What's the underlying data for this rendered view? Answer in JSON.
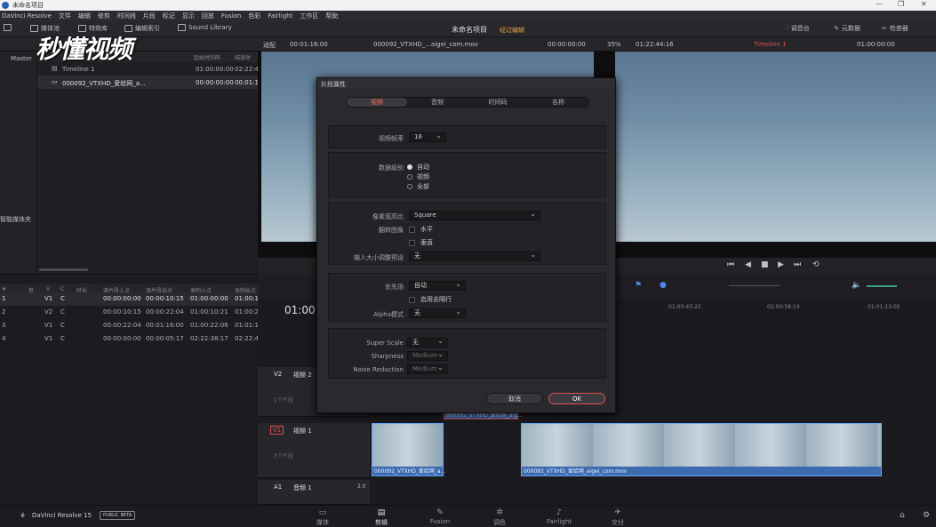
{
  "titlebar": {
    "title": "未命名项目"
  },
  "menubar": {
    "items": [
      "DaVinci Resolve",
      "文件",
      "编辑",
      "修剪",
      "时间线",
      "片段",
      "标记",
      "显示",
      "回放",
      "Fusion",
      "色彩",
      "Fairlight",
      "工作区",
      "帮助"
    ]
  },
  "toolbar": {
    "media_pool": "媒体池",
    "effects": "特效库",
    "edit_index": "编辑索引",
    "sound_library": "Sound Library",
    "project": "未命名项目",
    "edited": "经过编辑",
    "mixer": "调音台",
    "metadata": "元数据",
    "inspector": "检查器"
  },
  "watermark": "秒懂视频",
  "subbar": {
    "fit": "适配",
    "tc_left": "00:01:16:00",
    "clip_name": "000092_VTXHD_...aigei_com.mov",
    "tc_src": "00:00:00:00",
    "zoom": "35%",
    "tc_dur": "01:22:44:16",
    "timeline_name": "Timeline 1",
    "tc_right": "01:00:00:00"
  },
  "left": {
    "master": "Master",
    "smart_bins": "智能媒体夹"
  },
  "bin": {
    "headers": [
      "片段名称",
      "起始时间码",
      "结束时"
    ],
    "rows": [
      {
        "name": "Timeline 1",
        "start": "01:00:00:00",
        "end": "02:22:4"
      },
      {
        "name": "000092_VTXHD_爱给网_a...",
        "start": "00:00:00:00",
        "end": "00:01:1"
      }
    ]
  },
  "edit_index": {
    "headers": [
      "#",
      "卷",
      "V",
      "C",
      "时长",
      "源片段入点",
      "源片段出点",
      "录制入点",
      "录制出点"
    ],
    "rows": [
      [
        "1",
        "",
        "V1",
        "C",
        "",
        "00:00:00:00",
        "00:00:10:15",
        "01:00:00:00",
        "01:00:1"
      ],
      [
        "2",
        "",
        "V2",
        "C",
        "",
        "00:00:10:15",
        "00:00:22:04",
        "01:00:10:21",
        "01:00:2"
      ],
      [
        "3",
        "",
        "V1",
        "C",
        "",
        "00:00:22:04",
        "00:01:16:00",
        "01:00:22:06",
        "01:01:1"
      ],
      [
        "4",
        "",
        "V1",
        "C",
        "",
        "00:00:00:00",
        "00:00:05:17",
        "02:22:38:17",
        "02:22:4"
      ]
    ]
  },
  "timeline": {
    "tc": "01:00:",
    "ruler": [
      "01:00:43:22",
      "01:00:58:14",
      "01:01:13:05"
    ],
    "v2": {
      "id": "V2",
      "name": "视频 2",
      "clips": "1个片段"
    },
    "v1": {
      "id": "V1",
      "name": "视频 1",
      "clips": "3个片段"
    },
    "a1": {
      "id": "A1",
      "name": "音频 1",
      "level": "2.0"
    },
    "clip_a": "000092_VTXHD_爱给网_a...",
    "clip_b": "000092_VTXHD_爱给网_aigei_com.mov",
    "clip_c": "000092_VTXHD_爱给网_aig..."
  },
  "dialog": {
    "title": "片段属性",
    "tabs": [
      "视频",
      "音频",
      "时间码",
      "名称"
    ],
    "fps_label": "视频帧率",
    "fps": "16",
    "data_levels_label": "数据级别",
    "levels": [
      "自动",
      "视频",
      "全部"
    ],
    "par_label": "像素宽高比",
    "par": "Square",
    "flip_label": "翻转图像",
    "flip_h": "水平",
    "flip_v": "垂直",
    "resize_label": "输入大小调整预设",
    "resize": "无",
    "field_label": "优先场",
    "field": "自动",
    "deinterlace": "启用去隔行",
    "alpha_label": "Alpha模式",
    "alpha": "无",
    "ss_label": "Super Scale",
    "ss": "无",
    "sharp_label": "Sharpness",
    "sharp": "Medium",
    "nr_label": "Noise Reduction",
    "nr": "Medium",
    "cancel": "取消",
    "ok": "OK"
  },
  "pages": {
    "brand": "DaVinci Resolve 15",
    "beta": "PUBLIC BETA",
    "items": [
      "媒体",
      "剪辑",
      "Fusion",
      "调色",
      "Fairlight",
      "交付"
    ]
  }
}
